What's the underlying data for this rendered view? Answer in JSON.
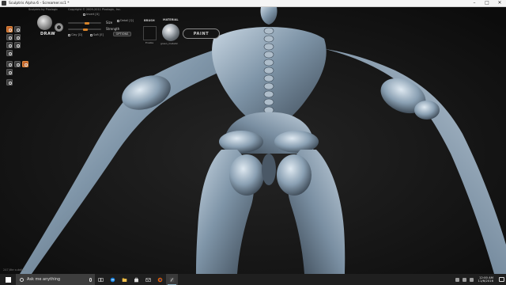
{
  "window": {
    "title": "Sculptris Alpha 6 - Screamer.sc1 *",
    "controls": [
      "–",
      "□",
      "✕"
    ]
  },
  "toolbar": {
    "credit": "Sculptris by Pixologic",
    "copyright": "Copyright © 2009-2011 Pixologic, Inc.",
    "draw_label": "DRAW",
    "options": {
      "invert_label": "Invert [X]",
      "size_label": "Size",
      "strength_label": "Strength",
      "detail_label": "Detail [Q]",
      "clay_label": "Clay [D]",
      "soft_label": "Soft [E]",
      "options_button": "OPTIONS"
    },
    "brush_label": "BRUSH",
    "brush_sub": "Enable",
    "material_label": "MATERIAL",
    "material_name": "green_metallic",
    "paint_button": "PAINT",
    "accent_color": "#d8842a"
  },
  "tools": [
    {
      "name": "tool-draw",
      "active": true
    },
    {
      "name": "tool-flatten",
      "active": false
    },
    {
      "name": "tool-crease",
      "active": false
    },
    {
      "name": "tool-inflate",
      "active": false
    },
    {
      "name": "tool-pinch",
      "active": false
    },
    {
      "name": "tool-grab",
      "active": false
    },
    {
      "name": "tool-smooth",
      "active": false
    },
    {
      "name": "tool-reduce",
      "active": false
    },
    {
      "name": "tool-rotate",
      "active": false
    },
    {
      "name": "tool-scale",
      "active": true
    },
    {
      "name": "tool-mask",
      "active": false
    },
    {
      "name": "tool-extra",
      "active": false
    }
  ],
  "status": {
    "text": "247,6te subdiv..."
  },
  "taskbar": {
    "search_placeholder": "Ask me anything",
    "apps": [
      "task-view",
      "edge",
      "file-explorer",
      "store",
      "mail",
      "firefox",
      "sculptris"
    ],
    "time": "12:00 AM",
    "date": "11/6/2016"
  }
}
